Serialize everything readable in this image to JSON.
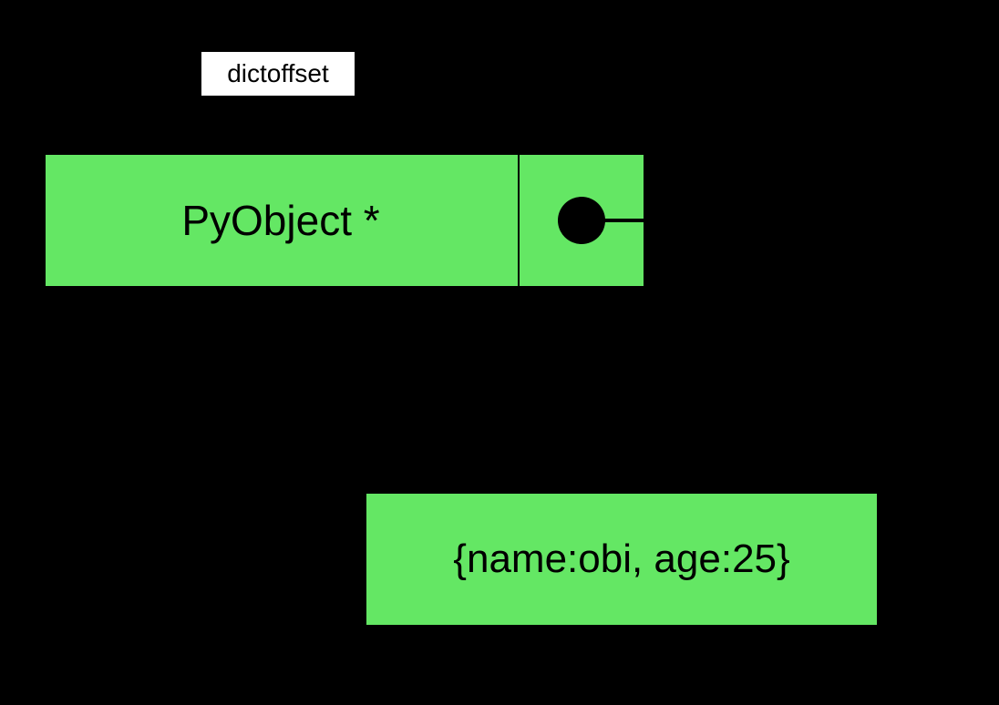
{
  "diagram": {
    "bracket_label": "dictoffset",
    "object_label": "PyObject *",
    "dict_content": "{name:obi, age:25}",
    "colors": {
      "bg": "#000000",
      "box_fill": "#64e764",
      "label_box_bg": "#ffffff",
      "stroke": "#000000"
    }
  }
}
